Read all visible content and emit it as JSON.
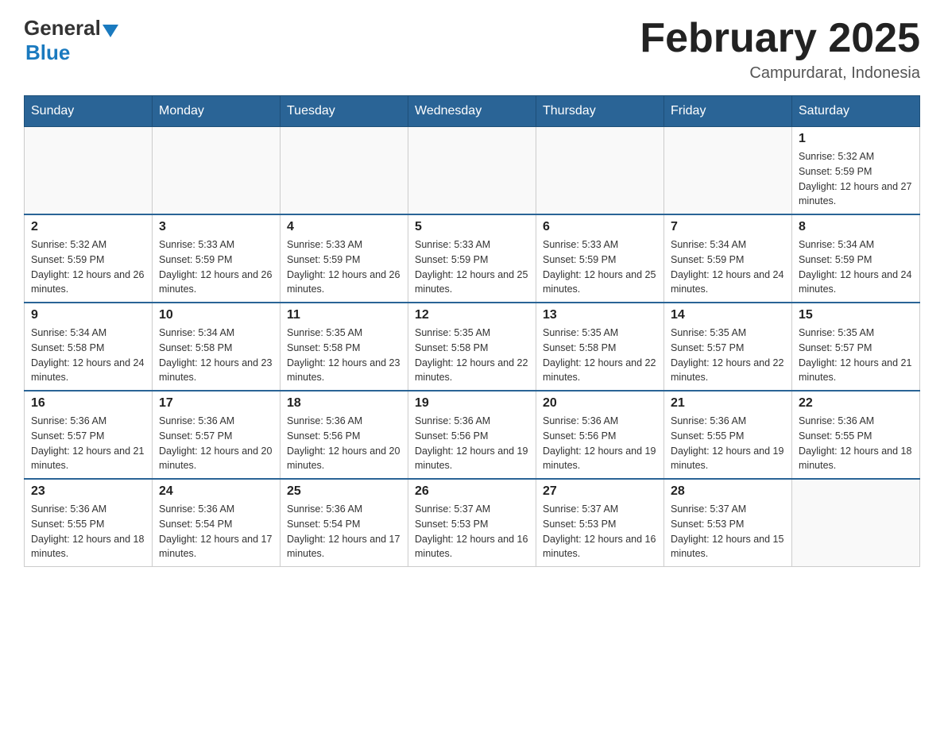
{
  "logo": {
    "general": "General",
    "blue": "Blue"
  },
  "title": "February 2025",
  "location": "Campurdarat, Indonesia",
  "days_of_week": [
    "Sunday",
    "Monday",
    "Tuesday",
    "Wednesday",
    "Thursday",
    "Friday",
    "Saturday"
  ],
  "weeks": [
    [
      {
        "day": "",
        "info": ""
      },
      {
        "day": "",
        "info": ""
      },
      {
        "day": "",
        "info": ""
      },
      {
        "day": "",
        "info": ""
      },
      {
        "day": "",
        "info": ""
      },
      {
        "day": "",
        "info": ""
      },
      {
        "day": "1",
        "info": "Sunrise: 5:32 AM\nSunset: 5:59 PM\nDaylight: 12 hours and 27 minutes."
      }
    ],
    [
      {
        "day": "2",
        "info": "Sunrise: 5:32 AM\nSunset: 5:59 PM\nDaylight: 12 hours and 26 minutes."
      },
      {
        "day": "3",
        "info": "Sunrise: 5:33 AM\nSunset: 5:59 PM\nDaylight: 12 hours and 26 minutes."
      },
      {
        "day": "4",
        "info": "Sunrise: 5:33 AM\nSunset: 5:59 PM\nDaylight: 12 hours and 26 minutes."
      },
      {
        "day": "5",
        "info": "Sunrise: 5:33 AM\nSunset: 5:59 PM\nDaylight: 12 hours and 25 minutes."
      },
      {
        "day": "6",
        "info": "Sunrise: 5:33 AM\nSunset: 5:59 PM\nDaylight: 12 hours and 25 minutes."
      },
      {
        "day": "7",
        "info": "Sunrise: 5:34 AM\nSunset: 5:59 PM\nDaylight: 12 hours and 24 minutes."
      },
      {
        "day": "8",
        "info": "Sunrise: 5:34 AM\nSunset: 5:59 PM\nDaylight: 12 hours and 24 minutes."
      }
    ],
    [
      {
        "day": "9",
        "info": "Sunrise: 5:34 AM\nSunset: 5:58 PM\nDaylight: 12 hours and 24 minutes."
      },
      {
        "day": "10",
        "info": "Sunrise: 5:34 AM\nSunset: 5:58 PM\nDaylight: 12 hours and 23 minutes."
      },
      {
        "day": "11",
        "info": "Sunrise: 5:35 AM\nSunset: 5:58 PM\nDaylight: 12 hours and 23 minutes."
      },
      {
        "day": "12",
        "info": "Sunrise: 5:35 AM\nSunset: 5:58 PM\nDaylight: 12 hours and 22 minutes."
      },
      {
        "day": "13",
        "info": "Sunrise: 5:35 AM\nSunset: 5:58 PM\nDaylight: 12 hours and 22 minutes."
      },
      {
        "day": "14",
        "info": "Sunrise: 5:35 AM\nSunset: 5:57 PM\nDaylight: 12 hours and 22 minutes."
      },
      {
        "day": "15",
        "info": "Sunrise: 5:35 AM\nSunset: 5:57 PM\nDaylight: 12 hours and 21 minutes."
      }
    ],
    [
      {
        "day": "16",
        "info": "Sunrise: 5:36 AM\nSunset: 5:57 PM\nDaylight: 12 hours and 21 minutes."
      },
      {
        "day": "17",
        "info": "Sunrise: 5:36 AM\nSunset: 5:57 PM\nDaylight: 12 hours and 20 minutes."
      },
      {
        "day": "18",
        "info": "Sunrise: 5:36 AM\nSunset: 5:56 PM\nDaylight: 12 hours and 20 minutes."
      },
      {
        "day": "19",
        "info": "Sunrise: 5:36 AM\nSunset: 5:56 PM\nDaylight: 12 hours and 19 minutes."
      },
      {
        "day": "20",
        "info": "Sunrise: 5:36 AM\nSunset: 5:56 PM\nDaylight: 12 hours and 19 minutes."
      },
      {
        "day": "21",
        "info": "Sunrise: 5:36 AM\nSunset: 5:55 PM\nDaylight: 12 hours and 19 minutes."
      },
      {
        "day": "22",
        "info": "Sunrise: 5:36 AM\nSunset: 5:55 PM\nDaylight: 12 hours and 18 minutes."
      }
    ],
    [
      {
        "day": "23",
        "info": "Sunrise: 5:36 AM\nSunset: 5:55 PM\nDaylight: 12 hours and 18 minutes."
      },
      {
        "day": "24",
        "info": "Sunrise: 5:36 AM\nSunset: 5:54 PM\nDaylight: 12 hours and 17 minutes."
      },
      {
        "day": "25",
        "info": "Sunrise: 5:36 AM\nSunset: 5:54 PM\nDaylight: 12 hours and 17 minutes."
      },
      {
        "day": "26",
        "info": "Sunrise: 5:37 AM\nSunset: 5:53 PM\nDaylight: 12 hours and 16 minutes."
      },
      {
        "day": "27",
        "info": "Sunrise: 5:37 AM\nSunset: 5:53 PM\nDaylight: 12 hours and 16 minutes."
      },
      {
        "day": "28",
        "info": "Sunrise: 5:37 AM\nSunset: 5:53 PM\nDaylight: 12 hours and 15 minutes."
      },
      {
        "day": "",
        "info": ""
      }
    ]
  ]
}
